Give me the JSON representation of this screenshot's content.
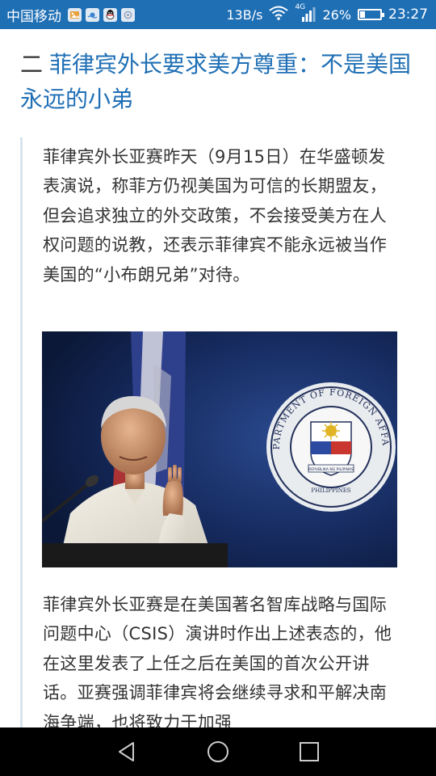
{
  "status_bar": {
    "carrier": "中国移动",
    "notification_icons": [
      "image-app-icon",
      "weather-app-icon",
      "qq-icon",
      "screenshot-app-icon"
    ],
    "net_speed": "13B/s",
    "network_type": "4G",
    "battery_percent": "26%",
    "battery_level": 0.26,
    "time": "23:27",
    "background_color": "#1f6fb5"
  },
  "article": {
    "heading_prefix": "二",
    "heading": "菲律宾外长要求美方尊重：不是美国永远的小弟",
    "paragraph_1": "菲律宾外长亚赛昨天（9月15日）在华盛顿发表演说，称菲方仍视美国为可信的长期盟友，但会追求独立的外交政策，不会接受美方在人权问题的说教，还表示菲律宾不能永远被当作美国的“小布朗兄弟”对待。",
    "photo_seal_text": "DEPARTMENT OF FOREIGN AFFAIRS",
    "photo_seal_bottom": "PHILIPPINES",
    "photo_seal_ribbon": "REPUBLIKA NG PILIPINAS",
    "paragraph_2": "菲律宾外长亚赛是在美国著名智库战略与国际问题中心（CSIS）演讲时作出上述表态的，他在这里发表了上任之后在美国的首次公开讲话。亚赛强调菲律宾将会继续寻求和平解决南海争端，也将致力于加强",
    "accent_color": "#1f6fb5"
  },
  "nav_bar": {
    "buttons": [
      "back-icon",
      "home-icon",
      "recents-icon"
    ]
  }
}
